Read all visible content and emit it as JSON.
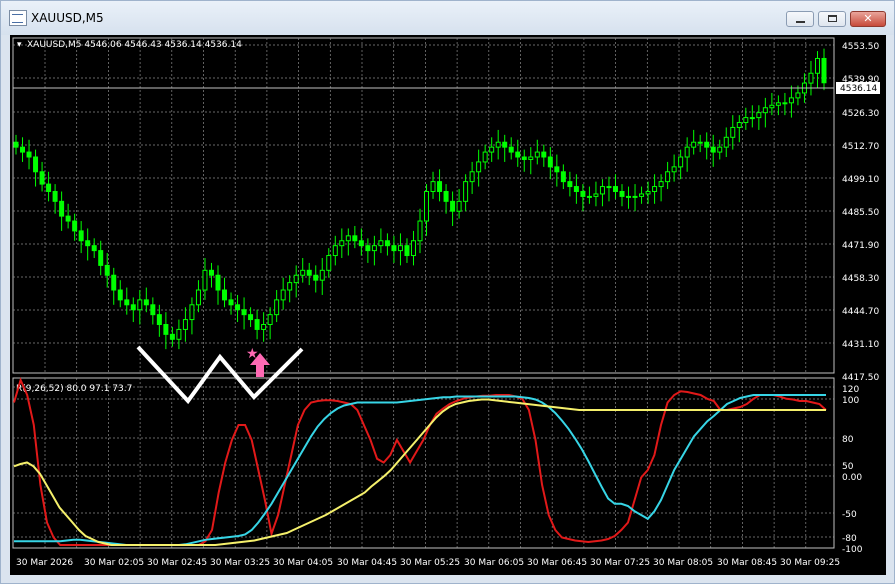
{
  "window": {
    "title": "XAUUSD,M5",
    "close_glyph": "✕"
  },
  "main_chart": {
    "header": "XAUUSD,M5  4546.06 4546.43 4536.14 4536.14",
    "price_ticks": [
      "4553.50",
      "4539.90",
      "4526.30",
      "4512.70",
      "4499.10",
      "4485.50",
      "4471.90",
      "4458.30",
      "4444.70",
      "4431.10",
      "4417.50"
    ],
    "current_price": "4536.14",
    "colors": {
      "background": "#000000",
      "candle": "#00ff00",
      "grid": "#c0c0c0",
      "annotation": "#ffffff",
      "arrow": "#ff69b4"
    }
  },
  "indicator": {
    "header": "R(9,26,52) 80.0 97.1 73.7",
    "ticks": [
      "120",
      "100",
      "80",
      "50",
      "0.00",
      "-50",
      "-80",
      "-100"
    ],
    "colors": {
      "red": "#e11919",
      "cyan": "#37d5e6",
      "yellow": "#f5f06b"
    }
  },
  "time_axis": [
    "30 Mar 2026",
    "30 Mar 02:05",
    "30 Mar 02:45",
    "30 Mar 03:25",
    "30 Mar 04:05",
    "30 Mar 04:45",
    "30 Mar 05:25",
    "30 Mar 06:05",
    "30 Mar 06:45",
    "30 Mar 07:25",
    "30 Mar 08:05",
    "30 Mar 08:45",
    "30 Mar 09:25"
  ],
  "chart_data": {
    "type": "line",
    "symbol": "XAUUSD",
    "timeframe": "M5",
    "ohlc_last": {
      "open": 4546.06,
      "high": 4546.43,
      "low": 4536.14,
      "close": 4536.14
    },
    "price_closes": [
      4510,
      4508,
      4506,
      4500,
      4495,
      4492,
      4488,
      4482,
      4480,
      4476,
      4472,
      4470,
      4468,
      4462,
      4458,
      4452,
      4448,
      4446,
      4444,
      4448,
      4446,
      4442,
      4438,
      4434,
      4432,
      4436,
      4440,
      4446,
      4452,
      4460,
      4458,
      4452,
      4448,
      4446,
      4444,
      4442,
      4440,
      4436,
      4438,
      4442,
      4448,
      4452,
      4455,
      4458,
      4460,
      4458,
      4456,
      4460,
      4466,
      4470,
      4472,
      4474,
      4472,
      4470,
      4468,
      4470,
      4472,
      4470,
      4468,
      4470,
      4466,
      4472,
      4480,
      4492,
      4496,
      4492,
      4488,
      4484,
      4488,
      4496,
      4500,
      4504,
      4508,
      4510,
      4512,
      4510,
      4508,
      4506,
      4505,
      4506,
      4508,
      4506,
      4502,
      4500,
      4496,
      4494,
      4492,
      4490,
      4490,
      4491,
      4494,
      4494,
      4492,
      4490,
      4490,
      4490,
      4491,
      4492,
      4494,
      4496,
      4500,
      4502,
      4506,
      4510,
      4512,
      4512,
      4510,
      4508,
      4510,
      4514,
      4518,
      4520,
      4522,
      4522,
      4524,
      4526,
      4527,
      4528,
      4528,
      4530,
      4532,
      4536,
      4540,
      4546,
      4536.14
    ],
    "indicator_series": [
      {
        "name": "",
        "color": "red",
        "values": [
          90,
          120,
          100,
          60,
          -20,
          -70,
          -90,
          -100,
          -100,
          -100,
          -100,
          -100,
          -100,
          -100,
          -100,
          -100,
          -100,
          -100,
          -100,
          -100,
          -100,
          -100,
          -100,
          -100,
          -100,
          -100,
          -100,
          -100,
          -100,
          -95,
          -80,
          -30,
          10,
          40,
          60,
          60,
          40,
          0,
          -40,
          -85,
          -60,
          -20,
          20,
          60,
          80,
          90,
          92,
          93,
          93,
          92,
          90,
          88,
          80,
          60,
          40,
          15,
          10,
          20,
          40,
          25,
          10,
          25,
          40,
          60,
          75,
          82,
          88,
          92,
          95,
          97,
          98,
          99,
          99,
          100,
          100,
          100,
          98,
          95,
          80,
          40,
          -20,
          -60,
          -80,
          -90,
          -92,
          -94,
          -95,
          -96,
          -95,
          -94,
          -92,
          -88,
          -80,
          -70,
          -40,
          -10,
          0,
          20,
          60,
          90,
          100,
          105,
          104,
          102,
          100,
          95,
          92,
          80,
          80,
          82,
          84,
          88,
          95,
          100,
          100,
          100,
          98,
          95,
          94,
          92,
          92,
          90,
          88,
          80
        ]
      },
      {
        "name": "",
        "color": "cyan",
        "values": [
          -95,
          -95,
          -95,
          -95,
          -95,
          -95,
          -95,
          -95,
          -94,
          -93,
          -93,
          -94,
          -95,
          -96,
          -97,
          -98,
          -99,
          -100,
          -100,
          -100,
          -100,
          -100,
          -100,
          -100,
          -100,
          -100,
          -99,
          -97,
          -95,
          -93,
          -92,
          -91,
          -90,
          -89,
          -88,
          -86,
          -80,
          -70,
          -58,
          -45,
          -30,
          -15,
          0,
          15,
          30,
          45,
          58,
          68,
          76,
          82,
          86,
          88,
          90,
          90,
          90,
          90,
          90,
          90,
          90,
          91,
          92,
          93,
          94,
          95,
          96,
          97,
          97,
          98,
          98,
          98,
          98,
          98,
          98,
          98,
          98,
          98,
          98,
          97,
          96,
          94,
          90,
          84,
          76,
          66,
          55,
          42,
          28,
          12,
          -5,
          -22,
          -38,
          -45,
          -45,
          -48,
          -55,
          -60,
          -65,
          -55,
          -40,
          -20,
          0,
          15,
          30,
          45,
          55,
          65,
          72,
          80,
          88,
          92,
          96,
          98,
          100,
          100,
          100,
          100,
          100,
          100,
          100,
          100,
          100,
          100,
          100,
          100
        ]
      },
      {
        "name": "",
        "color": "yellow",
        "values": [
          5,
          8,
          10,
          5,
          -5,
          -20,
          -35,
          -50,
          -60,
          -70,
          -80,
          -88,
          -92,
          -96,
          -98,
          -100,
          -100,
          -100,
          -100,
          -100,
          -100,
          -100,
          -100,
          -100,
          -100,
          -100,
          -100,
          -100,
          -100,
          -100,
          -100,
          -100,
          -99,
          -98,
          -97,
          -96,
          -95,
          -94,
          -92,
          -90,
          -88,
          -86,
          -84,
          -80,
          -76,
          -72,
          -68,
          -64,
          -60,
          -55,
          -50,
          -45,
          -40,
          -35,
          -30,
          -22,
          -15,
          -8,
          0,
          10,
          20,
          30,
          40,
          50,
          60,
          70,
          78,
          84,
          88,
          90,
          92,
          93,
          94,
          94,
          93,
          92,
          91,
          90,
          89,
          88,
          87,
          86,
          85,
          84,
          83,
          82,
          81,
          80,
          80,
          80,
          80,
          80,
          80,
          80,
          80,
          80,
          80,
          80,
          80,
          80,
          80,
          80,
          80,
          80,
          80,
          80,
          80,
          80,
          80,
          80,
          80,
          80,
          80,
          80,
          80,
          80,
          80,
          80,
          80,
          80,
          80,
          80,
          80,
          80,
          80,
          80
        ]
      }
    ],
    "ylim_price": [
      4417.5,
      4553.5
    ],
    "ylim_indicator": [
      -100,
      120
    ],
    "grid": true
  }
}
